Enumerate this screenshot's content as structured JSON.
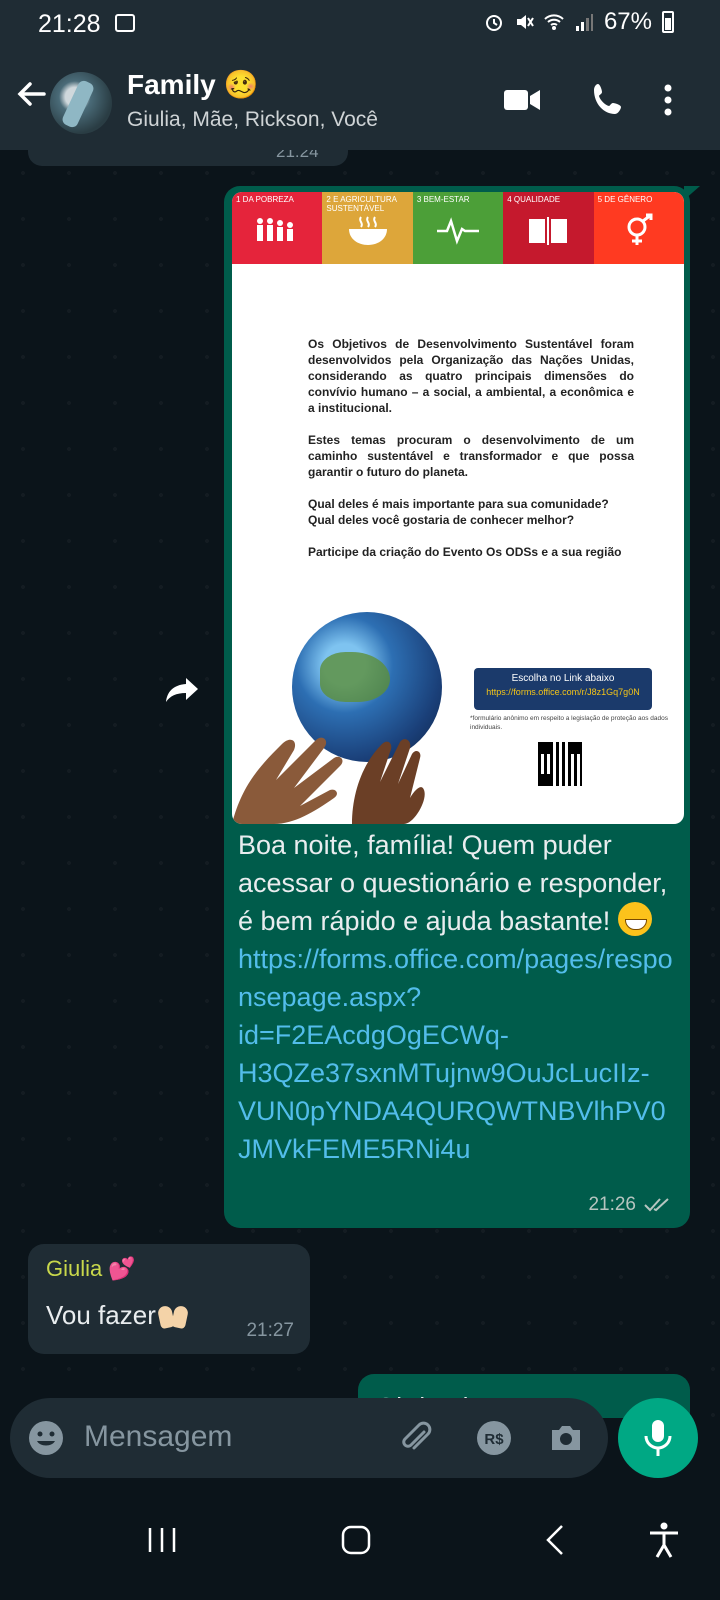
{
  "status_bar": {
    "time": "21:28",
    "battery": "67%"
  },
  "header": {
    "title": "Family",
    "title_emoji": "🥴",
    "subtitle": "Giulia, Mãe, Rickson, Você"
  },
  "chat": {
    "previous_time": "21:24",
    "flyer": {
      "tiles": [
        {
          "label": "1  DA POBREZA",
          "color": "#e5243b"
        },
        {
          "label": "2  E AGRICULTURA SUSTENTÁVEL",
          "color": "#dda63a"
        },
        {
          "label": "3  BEM-ESTAR",
          "color": "#4c9f38"
        },
        {
          "label": "4  QUALIDADE",
          "color": "#c5192d"
        },
        {
          "label": "5  DE GÊNERO",
          "color": "#ff3a21"
        }
      ],
      "paragraphs": [
        "Os Objetivos de Desenvolvimento Sustentável foram desenvolvidos pela Organização das Nações Unidas, considerando as quatro principais dimensões do convívio humano – a social, a ambiental, a econômica e a institucional.",
        "Estes temas procuram o desenvolvimento de um caminho sustentável e transformador e que possa garantir o futuro do planeta.",
        "Qual deles é mais importante para sua comunidade? Qual deles você gostaria de conhecer melhor?",
        "Participe da criação do Evento Os ODSs e a sua região"
      ],
      "link_box_title": "Escolha no Link abaixo",
      "link_box_url": "https://forms.office.com/r/J8z1Gq7g0N",
      "note": "*formulário anônimo em respeito a legislação de proteção aos dados individuais."
    },
    "outgoing_text": "Boa noite, família! Quem puder acessar o questionário e responder, é bem rápido e ajuda bastante!",
    "outgoing_link": "https://forms.office.com/pages/responsepage.aspx?id=F2EAcdgOgECWq-H3QZe37sxnMTujnw9OuJcLucIIz-VUN0pYNDA4QURQWTNBVlhPV0JMVkFEME5RNi4u",
    "outgoing_time": "21:26",
    "incoming_sender": "Giulia",
    "incoming_text": "Vou fazer",
    "incoming_time": "21:27",
    "last_outgoing_text": "Obrigada!"
  },
  "composer": {
    "placeholder": "Mensagem"
  },
  "colors": {
    "accent": "#00a884",
    "outgoing_bubble": "#005c4b",
    "incoming_bubble": "#1f2c34",
    "link": "#53bdeb"
  }
}
